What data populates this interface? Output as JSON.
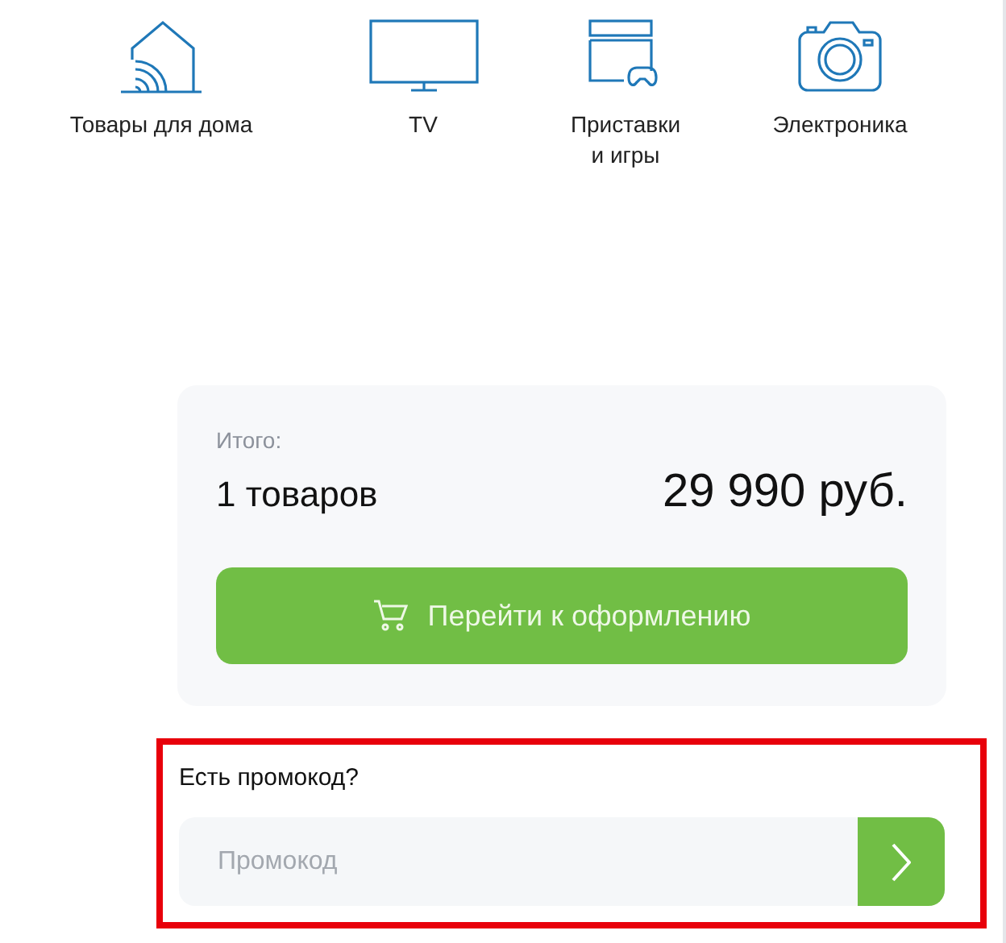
{
  "categories": [
    {
      "kind": "home",
      "label": "Товары для дома"
    },
    {
      "kind": "tv",
      "label": "TV"
    },
    {
      "kind": "console",
      "label": "Приставки и игры"
    },
    {
      "kind": "camera",
      "label": "Электроника"
    }
  ],
  "summary": {
    "caption": "Итого:",
    "count": "1 товаров",
    "total": "29 990 руб.",
    "checkout_button": "Перейти к оформлению"
  },
  "promo": {
    "highlighted": true,
    "title": "Есть промокод?",
    "placeholder": "Промокод"
  }
}
